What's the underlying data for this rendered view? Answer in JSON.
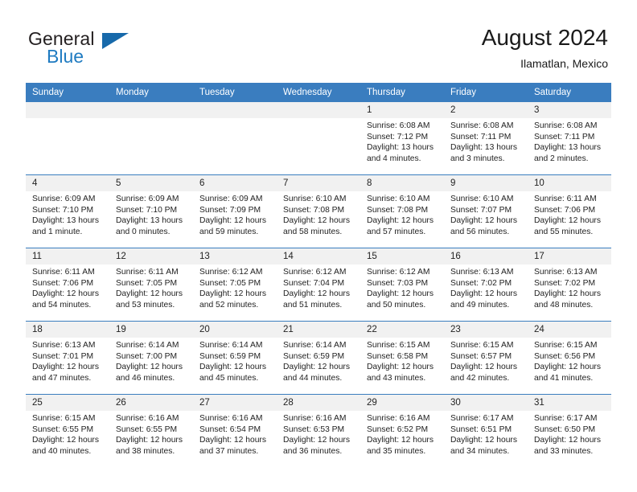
{
  "brand": {
    "line1": "General",
    "line2": "Blue",
    "mark_icon": "triangle-logo-icon"
  },
  "header": {
    "title": "August 2024",
    "subtitle": "Ilamatlan, Mexico"
  },
  "colors": {
    "header_blue": "#3a7dbf",
    "brand_blue": "#1f7bc1",
    "daynum_band": "#f1f1f1",
    "text": "#1f1f1f"
  },
  "weekdays": [
    "Sunday",
    "Monday",
    "Tuesday",
    "Wednesday",
    "Thursday",
    "Friday",
    "Saturday"
  ],
  "weeks": [
    [
      {
        "day": "",
        "sunrise": "",
        "sunset": "",
        "daylight_1": "",
        "daylight_2": ""
      },
      {
        "day": "",
        "sunrise": "",
        "sunset": "",
        "daylight_1": "",
        "daylight_2": ""
      },
      {
        "day": "",
        "sunrise": "",
        "sunset": "",
        "daylight_1": "",
        "daylight_2": ""
      },
      {
        "day": "",
        "sunrise": "",
        "sunset": "",
        "daylight_1": "",
        "daylight_2": ""
      },
      {
        "day": "1",
        "sunrise": "Sunrise: 6:08 AM",
        "sunset": "Sunset: 7:12 PM",
        "daylight_1": "Daylight: 13 hours",
        "daylight_2": "and 4 minutes."
      },
      {
        "day": "2",
        "sunrise": "Sunrise: 6:08 AM",
        "sunset": "Sunset: 7:11 PM",
        "daylight_1": "Daylight: 13 hours",
        "daylight_2": "and 3 minutes."
      },
      {
        "day": "3",
        "sunrise": "Sunrise: 6:08 AM",
        "sunset": "Sunset: 7:11 PM",
        "daylight_1": "Daylight: 13 hours",
        "daylight_2": "and 2 minutes."
      }
    ],
    [
      {
        "day": "4",
        "sunrise": "Sunrise: 6:09 AM",
        "sunset": "Sunset: 7:10 PM",
        "daylight_1": "Daylight: 13 hours",
        "daylight_2": "and 1 minute."
      },
      {
        "day": "5",
        "sunrise": "Sunrise: 6:09 AM",
        "sunset": "Sunset: 7:10 PM",
        "daylight_1": "Daylight: 13 hours",
        "daylight_2": "and 0 minutes."
      },
      {
        "day": "6",
        "sunrise": "Sunrise: 6:09 AM",
        "sunset": "Sunset: 7:09 PM",
        "daylight_1": "Daylight: 12 hours",
        "daylight_2": "and 59 minutes."
      },
      {
        "day": "7",
        "sunrise": "Sunrise: 6:10 AM",
        "sunset": "Sunset: 7:08 PM",
        "daylight_1": "Daylight: 12 hours",
        "daylight_2": "and 58 minutes."
      },
      {
        "day": "8",
        "sunrise": "Sunrise: 6:10 AM",
        "sunset": "Sunset: 7:08 PM",
        "daylight_1": "Daylight: 12 hours",
        "daylight_2": "and 57 minutes."
      },
      {
        "day": "9",
        "sunrise": "Sunrise: 6:10 AM",
        "sunset": "Sunset: 7:07 PM",
        "daylight_1": "Daylight: 12 hours",
        "daylight_2": "and 56 minutes."
      },
      {
        "day": "10",
        "sunrise": "Sunrise: 6:11 AM",
        "sunset": "Sunset: 7:06 PM",
        "daylight_1": "Daylight: 12 hours",
        "daylight_2": "and 55 minutes."
      }
    ],
    [
      {
        "day": "11",
        "sunrise": "Sunrise: 6:11 AM",
        "sunset": "Sunset: 7:06 PM",
        "daylight_1": "Daylight: 12 hours",
        "daylight_2": "and 54 minutes."
      },
      {
        "day": "12",
        "sunrise": "Sunrise: 6:11 AM",
        "sunset": "Sunset: 7:05 PM",
        "daylight_1": "Daylight: 12 hours",
        "daylight_2": "and 53 minutes."
      },
      {
        "day": "13",
        "sunrise": "Sunrise: 6:12 AM",
        "sunset": "Sunset: 7:05 PM",
        "daylight_1": "Daylight: 12 hours",
        "daylight_2": "and 52 minutes."
      },
      {
        "day": "14",
        "sunrise": "Sunrise: 6:12 AM",
        "sunset": "Sunset: 7:04 PM",
        "daylight_1": "Daylight: 12 hours",
        "daylight_2": "and 51 minutes."
      },
      {
        "day": "15",
        "sunrise": "Sunrise: 6:12 AM",
        "sunset": "Sunset: 7:03 PM",
        "daylight_1": "Daylight: 12 hours",
        "daylight_2": "and 50 minutes."
      },
      {
        "day": "16",
        "sunrise": "Sunrise: 6:13 AM",
        "sunset": "Sunset: 7:02 PM",
        "daylight_1": "Daylight: 12 hours",
        "daylight_2": "and 49 minutes."
      },
      {
        "day": "17",
        "sunrise": "Sunrise: 6:13 AM",
        "sunset": "Sunset: 7:02 PM",
        "daylight_1": "Daylight: 12 hours",
        "daylight_2": "and 48 minutes."
      }
    ],
    [
      {
        "day": "18",
        "sunrise": "Sunrise: 6:13 AM",
        "sunset": "Sunset: 7:01 PM",
        "daylight_1": "Daylight: 12 hours",
        "daylight_2": "and 47 minutes."
      },
      {
        "day": "19",
        "sunrise": "Sunrise: 6:14 AM",
        "sunset": "Sunset: 7:00 PM",
        "daylight_1": "Daylight: 12 hours",
        "daylight_2": "and 46 minutes."
      },
      {
        "day": "20",
        "sunrise": "Sunrise: 6:14 AM",
        "sunset": "Sunset: 6:59 PM",
        "daylight_1": "Daylight: 12 hours",
        "daylight_2": "and 45 minutes."
      },
      {
        "day": "21",
        "sunrise": "Sunrise: 6:14 AM",
        "sunset": "Sunset: 6:59 PM",
        "daylight_1": "Daylight: 12 hours",
        "daylight_2": "and 44 minutes."
      },
      {
        "day": "22",
        "sunrise": "Sunrise: 6:15 AM",
        "sunset": "Sunset: 6:58 PM",
        "daylight_1": "Daylight: 12 hours",
        "daylight_2": "and 43 minutes."
      },
      {
        "day": "23",
        "sunrise": "Sunrise: 6:15 AM",
        "sunset": "Sunset: 6:57 PM",
        "daylight_1": "Daylight: 12 hours",
        "daylight_2": "and 42 minutes."
      },
      {
        "day": "24",
        "sunrise": "Sunrise: 6:15 AM",
        "sunset": "Sunset: 6:56 PM",
        "daylight_1": "Daylight: 12 hours",
        "daylight_2": "and 41 minutes."
      }
    ],
    [
      {
        "day": "25",
        "sunrise": "Sunrise: 6:15 AM",
        "sunset": "Sunset: 6:55 PM",
        "daylight_1": "Daylight: 12 hours",
        "daylight_2": "and 40 minutes."
      },
      {
        "day": "26",
        "sunrise": "Sunrise: 6:16 AM",
        "sunset": "Sunset: 6:55 PM",
        "daylight_1": "Daylight: 12 hours",
        "daylight_2": "and 38 minutes."
      },
      {
        "day": "27",
        "sunrise": "Sunrise: 6:16 AM",
        "sunset": "Sunset: 6:54 PM",
        "daylight_1": "Daylight: 12 hours",
        "daylight_2": "and 37 minutes."
      },
      {
        "day": "28",
        "sunrise": "Sunrise: 6:16 AM",
        "sunset": "Sunset: 6:53 PM",
        "daylight_1": "Daylight: 12 hours",
        "daylight_2": "and 36 minutes."
      },
      {
        "day": "29",
        "sunrise": "Sunrise: 6:16 AM",
        "sunset": "Sunset: 6:52 PM",
        "daylight_1": "Daylight: 12 hours",
        "daylight_2": "and 35 minutes."
      },
      {
        "day": "30",
        "sunrise": "Sunrise: 6:17 AM",
        "sunset": "Sunset: 6:51 PM",
        "daylight_1": "Daylight: 12 hours",
        "daylight_2": "and 34 minutes."
      },
      {
        "day": "31",
        "sunrise": "Sunrise: 6:17 AM",
        "sunset": "Sunset: 6:50 PM",
        "daylight_1": "Daylight: 12 hours",
        "daylight_2": "and 33 minutes."
      }
    ]
  ]
}
